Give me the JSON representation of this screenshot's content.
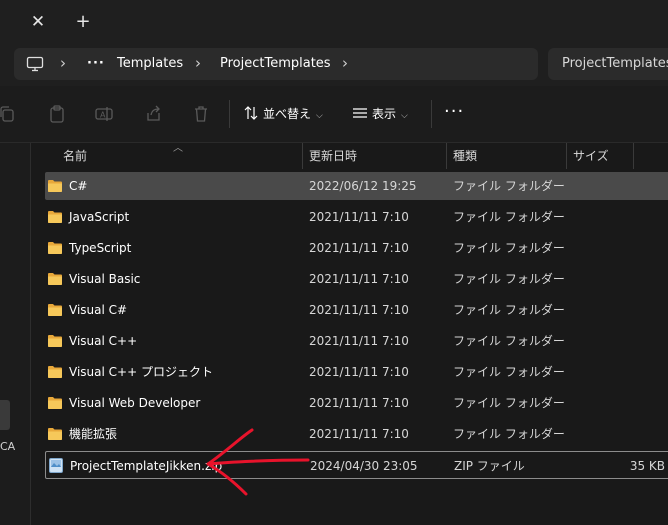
{
  "window": {
    "tab_close_glyph": "✕",
    "tab_new_glyph": "+"
  },
  "address": {
    "computer_icon": "computer-icon",
    "ellipsis": "···",
    "crumbs": [
      "Templates",
      "ProjectTemplates"
    ],
    "separator": "›",
    "search_text": "ProjectTemplatesの"
  },
  "toolbar": {
    "sort_label": "並べ替え",
    "view_label": "表示",
    "more_label": "···",
    "chevron": "⌵"
  },
  "columns": {
    "name": "名前",
    "date": "更新日時",
    "type": "種類",
    "size": "サイズ"
  },
  "files": [
    {
      "name": "C#",
      "date": "2022/06/12 19:25",
      "type": "ファイル フォルダー",
      "size": "",
      "icon": "folder-icon"
    },
    {
      "name": "JavaScript",
      "date": "2021/11/11 7:10",
      "type": "ファイル フォルダー",
      "size": "",
      "icon": "folder-icon"
    },
    {
      "name": "TypeScript",
      "date": "2021/11/11 7:10",
      "type": "ファイル フォルダー",
      "size": "",
      "icon": "folder-icon"
    },
    {
      "name": "Visual Basic",
      "date": "2021/11/11 7:10",
      "type": "ファイル フォルダー",
      "size": "",
      "icon": "folder-icon"
    },
    {
      "name": "Visual C#",
      "date": "2021/11/11 7:10",
      "type": "ファイル フォルダー",
      "size": "",
      "icon": "folder-icon"
    },
    {
      "name": "Visual C++",
      "date": "2021/11/11 7:10",
      "type": "ファイル フォルダー",
      "size": "",
      "icon": "folder-icon"
    },
    {
      "name": "Visual C++ プロジェクト",
      "date": "2021/11/11 7:10",
      "type": "ファイル フォルダー",
      "size": "",
      "icon": "folder-icon"
    },
    {
      "name": "Visual Web Developer",
      "date": "2021/11/11 7:10",
      "type": "ファイル フォルダー",
      "size": "",
      "icon": "folder-icon"
    },
    {
      "name": "機能拡張",
      "date": "2021/11/11 7:10",
      "type": "ファイル フォルダー",
      "size": "",
      "icon": "folder-icon"
    },
    {
      "name": "ProjectTemplateJikken.zip",
      "date": "2024/04/30 23:05",
      "type": "ZIP ファイル",
      "size": "35 KB",
      "icon": "zip-file-icon"
    }
  ],
  "nav": {
    "partial_text": "CA"
  },
  "colors": {
    "background": "#191919",
    "selected_row": "#4a4a4a",
    "folder": "#f4c34a",
    "annotation_arrow": "#e8132b"
  }
}
